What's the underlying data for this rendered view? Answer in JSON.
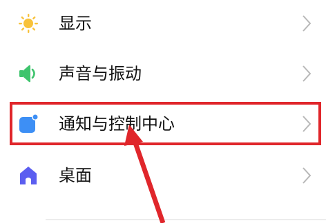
{
  "settings": {
    "items": [
      {
        "label": "显示",
        "icon": "sun-icon"
      },
      {
        "label": "声音与振动",
        "icon": "speaker-icon"
      },
      {
        "label": "通知与控制中心",
        "icon": "notification-square-icon"
      },
      {
        "label": "桌面",
        "icon": "home-icon"
      }
    ],
    "chevron_icon": "chevron-right-icon"
  },
  "annotation": {
    "highlight_color": "#e0262b",
    "arrow_color": "#e0262b"
  },
  "colors": {
    "sun": "#f8c23a",
    "speaker": "#3ec46d",
    "notification": "#3d8ff5",
    "home": "#5b5ef0",
    "chevron": "#b8b8b8"
  }
}
